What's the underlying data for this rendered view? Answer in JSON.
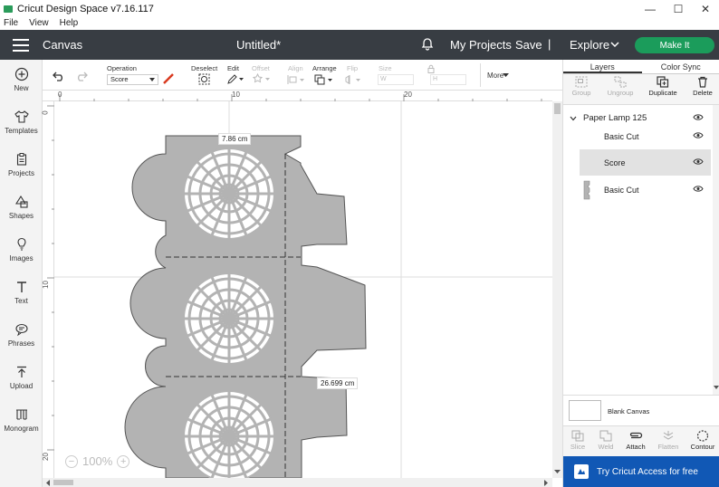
{
  "titlebar": {
    "title": "Cricut Design Space   v7.16.117",
    "minimize": "—",
    "maximize": "☐",
    "close": "✕"
  },
  "menu": [
    "File",
    "View",
    "Help"
  ],
  "header": {
    "section": "Canvas",
    "doc_title": "Untitled*",
    "my_projects": "My Projects",
    "save": "Save",
    "separator": "|",
    "explore": "Explore",
    "make_it": "Make It"
  },
  "sidebar": {
    "items": [
      {
        "label": "New",
        "icon": "plus-circle-icon"
      },
      {
        "label": "Templates",
        "icon": "tshirt-icon"
      },
      {
        "label": "Projects",
        "icon": "clipboard-icon"
      },
      {
        "label": "Shapes",
        "icon": "shapes-icon"
      },
      {
        "label": "Images",
        "icon": "bulb-icon"
      },
      {
        "label": "Text",
        "icon": "text-icon"
      },
      {
        "label": "Phrases",
        "icon": "speech-icon"
      },
      {
        "label": "Upload",
        "icon": "upload-icon"
      },
      {
        "label": "Monogram",
        "icon": "monogram-icon"
      }
    ]
  },
  "toolbar": {
    "operation_label": "Operation",
    "operation_value": "Score",
    "deselect": "Deselect",
    "edit": "Edit",
    "offset": "Offset",
    "align": "Align",
    "arrange": "Arrange",
    "flip": "Flip",
    "size": "Size",
    "w_label": "W",
    "h_label": "H",
    "more": "More"
  },
  "ruler": {
    "top_ticks": [
      "0",
      "10",
      "20"
    ],
    "left_ticks": [
      "0",
      "10",
      "20"
    ]
  },
  "canvas": {
    "width_label": "7.86 cm",
    "height_label": "26.699 cm",
    "zoom": "100%",
    "zoom_minus": "−",
    "zoom_plus": "+"
  },
  "panel": {
    "tabs": [
      "Layers",
      "Color Sync"
    ],
    "actions": [
      {
        "label": "Group",
        "enabled": false
      },
      {
        "label": "Ungroup",
        "enabled": false
      },
      {
        "label": "Duplicate",
        "enabled": true
      },
      {
        "label": "Delete",
        "enabled": true
      }
    ],
    "group_name": "Paper Lamp 125",
    "layers": [
      {
        "name": "Basic Cut",
        "selected": false
      },
      {
        "name": "Score",
        "selected": true
      },
      {
        "name": "Basic Cut",
        "selected": false
      }
    ],
    "blank_canvas": "Blank Canvas",
    "bottom_actions": [
      {
        "label": "Slice",
        "enabled": false
      },
      {
        "label": "Weld",
        "enabled": false
      },
      {
        "label": "Attach",
        "enabled": true
      },
      {
        "label": "Flatten",
        "enabled": false
      },
      {
        "label": "Contour",
        "enabled": true
      }
    ],
    "promo": "Try Cricut Access for free"
  },
  "colors": {
    "header_bg": "#383d43",
    "make_it": "#1b9c5b",
    "promo": "#1158b5",
    "shape_fill": "#b3b3b3"
  }
}
